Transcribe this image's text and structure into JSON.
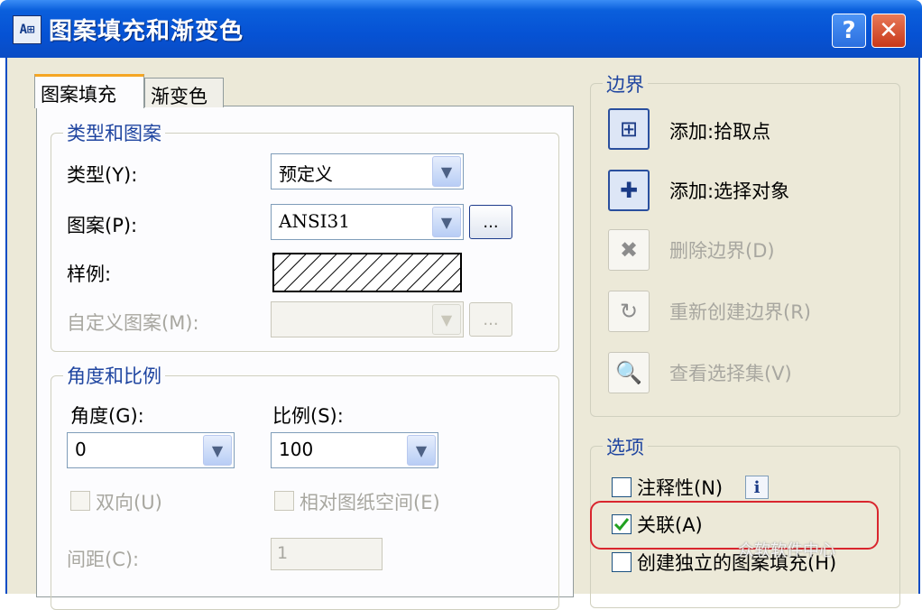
{
  "window": {
    "title": "图案填充和渐变色",
    "app_icon_text": "A⊞",
    "help_glyph": "?",
    "close_glyph": "✕"
  },
  "tabs": [
    {
      "label": "图案填充",
      "active": true
    },
    {
      "label": "渐变色",
      "active": false
    }
  ],
  "type_group": {
    "title": "类型和图案",
    "type_label": "类型(Y):",
    "type_value": "预定义",
    "pattern_label": "图案(P):",
    "pattern_value": "ANSI31",
    "pattern_browse": "...",
    "sample_label": "样例:",
    "custom_label": "自定义图案(M):",
    "custom_value": "",
    "custom_browse": "..."
  },
  "angle_group": {
    "title": "角度和比例",
    "angle_label": "角度(G):",
    "angle_value": "0",
    "scale_label": "比例(S):",
    "scale_value": "100",
    "double_label": "双向(U)",
    "relative_label": "相对图纸空间(E)",
    "spacing_label": "间距(C):",
    "spacing_value": "1"
  },
  "boundary": {
    "title": "边界",
    "add_pick": "添加:拾取点",
    "add_select": "添加:选择对象",
    "remove": "删除边界(D)",
    "recreate": "重新创建边界(R)",
    "view": "查看选择集(V)"
  },
  "options": {
    "title": "选项",
    "annotative": "注释性(N)",
    "annotative_checked": false,
    "info_glyph": "i",
    "associative": "关联(A)",
    "associative_checked": true,
    "separate": "创建独立的图案填充(H)",
    "separate_checked": false
  },
  "watermark": "众软软件中心",
  "colors": {
    "title_blue": "#0652d4",
    "highlight_red": "#d9262e",
    "dialog_bg": "#ece9d8",
    "group_title": "#1f45a0"
  }
}
